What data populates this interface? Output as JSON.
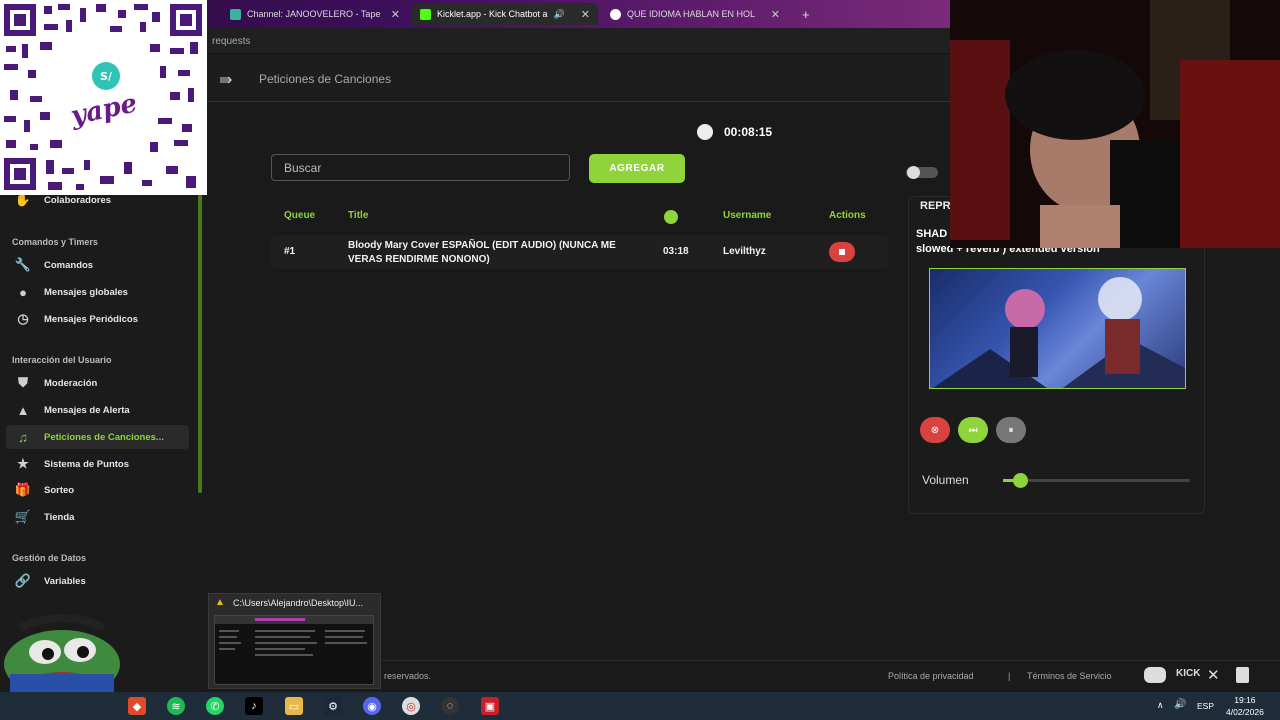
{
  "browser": {
    "tabs": [
      {
        "title": "Channel: JANOOVELERO - Tape"
      },
      {
        "title": "Kicklet.app - Kick Chatbot a"
      },
      {
        "title": "QUE IDIOMA HABLAN EN HOL"
      }
    ],
    "address": "requests"
  },
  "header": {
    "title": "Peticiones de Canciones"
  },
  "sidebar": {
    "top_item": "Colaboradores",
    "sections": [
      {
        "title": "Comandos y Timers"
      },
      {
        "title": "Interacción del Usuario"
      },
      {
        "title": "Gestión de Datos"
      }
    ],
    "items": [
      {
        "label": "Comandos"
      },
      {
        "label": "Mensajes globales"
      },
      {
        "label": "Mensajes Periódicos"
      },
      {
        "label": "Moderación"
      },
      {
        "label": "Mensajes de Alerta"
      },
      {
        "label": "Peticiones de Canciones..."
      },
      {
        "label": "Sistema de Puntos"
      },
      {
        "label": "Sorteo"
      },
      {
        "label": "Tienda"
      },
      {
        "label": "Variables"
      }
    ]
  },
  "main": {
    "timer": "00:08:15",
    "search_placeholder": "Buscar",
    "add_label": "AGREGAR",
    "table": {
      "headers": {
        "queue": "Queue",
        "title": "Title",
        "username": "Username",
        "actions": "Actions"
      },
      "rows": [
        {
          "queue": "#1",
          "title": "Bloody Mary Cover ESPAÑOL (EDIT AUDIO) (NUNCA ME VERAS RENDIRME NONONO)",
          "duration": "03:18",
          "username": "Levilthyz"
        }
      ]
    }
  },
  "player": {
    "label": "REPR",
    "song_title_line1": "SHAD",
    "song_title_line2": "slowed + reverb ) extended version",
    "volume_label": "Volumen",
    "volume_level": 0.09
  },
  "qr": {
    "brand": "yape"
  },
  "popup": {
    "title": "C:\\Users\\Alejandro\\Desktop\\IU..."
  },
  "footer": {
    "rights": "reservados.",
    "privacy": "Política de privacidad",
    "separator": "|",
    "terms": "Términos de Servicio"
  },
  "taskbar": {
    "lang": "ESP",
    "time": "19:16",
    "date": "4/02/2026"
  },
  "colors": {
    "accent": "#8ed43a",
    "danger": "#d9433f",
    "background": "#1a1a1a"
  }
}
